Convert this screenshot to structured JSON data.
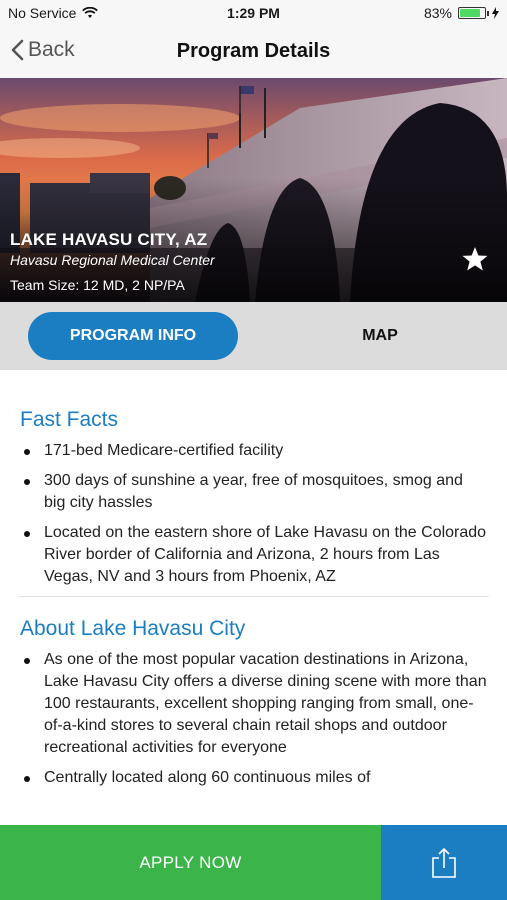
{
  "status_bar": {
    "carrier": "No Service",
    "time": "1:29 PM",
    "battery": "83%",
    "battery_level": 0.83
  },
  "nav": {
    "back_label": "Back",
    "title": "Program Details"
  },
  "hero": {
    "city": "LAKE HAVASU CITY, AZ",
    "facility": "Havasu Regional Medical Center",
    "team_size": "Team Size: 12 MD, 2 NP/PA",
    "favorite_icon": "star-icon"
  },
  "tabs": {
    "program_info": "PROGRAM INFO",
    "map": "MAP"
  },
  "sections": [
    {
      "heading": "Fast Facts",
      "items": [
        "171-bed Medicare-certified facility",
        "300 days of sunshine a year, free of mosquitoes, smog and big city hassles",
        "Located on the eastern shore of Lake Havasu on the Colorado River border of California and Arizona, 2 hours from Las Vegas, NV and 3 hours from Phoenix, AZ"
      ]
    },
    {
      "heading": "About Lake Havasu City",
      "items": [
        "As one of the most popular vacation destinations in Arizona, Lake Havasu City offers a diverse dining scene with more than 100 restaurants, excellent shopping ranging from small, one-of-a-kind stores to several chain retail shops and outdoor recreational activities for everyone",
        "Centrally located along 60 continuous miles of"
      ]
    }
  ],
  "bottom_bar": {
    "apply_label": "APPLY NOW",
    "share_icon": "share-icon"
  },
  "colors": {
    "accent_blue": "#1b7ec3",
    "apply_green": "#3bb54a",
    "tab_bg": "#dcdcdc"
  }
}
